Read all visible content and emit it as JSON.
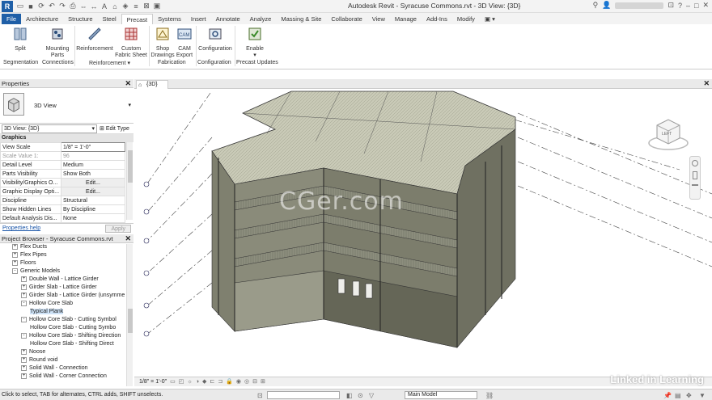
{
  "titlebar": {
    "logo": "R",
    "title": "Autodesk Revit - Syracuse Commons.rvt - 3D View: {3D}"
  },
  "ribbon_tabs": [
    "File",
    "Architecture",
    "Structure",
    "Steel",
    "Precast",
    "Systems",
    "Insert",
    "Annotate",
    "Analyze",
    "Massing & Site",
    "Collaborate",
    "View",
    "Manage",
    "Add-Ins",
    "Modify"
  ],
  "ribbon": {
    "buttons": {
      "split": "Split",
      "mounting": "Mounting Parts",
      "reinforcement": "Reinforcement",
      "custom_fabric": "Custom Fabric Sheet",
      "shop_drawings": "Shop Drawings",
      "cam_export": "CAM Export",
      "configuration": "Configuration",
      "enable": "Enable"
    },
    "groups": {
      "segmentation": "Segmentation",
      "connections": "Connections",
      "reinforcement": "Reinforcement ▾",
      "fabrication": "Fabrication",
      "configuration": "Configuration",
      "updates": "Precast Updates"
    }
  },
  "properties": {
    "title": "Properties",
    "type_name": "3D View",
    "view_select": "3D View: {3D}",
    "edit_type": "Edit Type",
    "section": "Graphics",
    "rows": [
      {
        "k": "View Scale",
        "v": "1/8\" = 1'-0\""
      },
      {
        "k": "Scale Value    1:",
        "v": "96"
      },
      {
        "k": "Detail Level",
        "v": "Medium"
      },
      {
        "k": "Parts Visibility",
        "v": "Show Both"
      },
      {
        "k": "Visibility/Graphics O...",
        "v": "Edit..."
      },
      {
        "k": "Graphic Display Opti...",
        "v": "Edit..."
      },
      {
        "k": "Discipline",
        "v": "Structural"
      },
      {
        "k": "Show Hidden Lines",
        "v": "By Discipline"
      },
      {
        "k": "Default Analysis Dis...",
        "v": "None"
      }
    ],
    "help": "Properties help",
    "apply": "Apply"
  },
  "browser": {
    "title": "Project Browser - Syracuse Commons.rvt",
    "items": [
      {
        "label": "Flex Ducts",
        "indent": 1,
        "exp": "+"
      },
      {
        "label": "Flex Pipes",
        "indent": 1,
        "exp": "+"
      },
      {
        "label": "Floors",
        "indent": 1,
        "exp": "+"
      },
      {
        "label": "Generic Models",
        "indent": 1,
        "exp": "-"
      },
      {
        "label": "Double Wall - Lattice Girder",
        "indent": 2,
        "exp": "+"
      },
      {
        "label": "Girder Slab - Lattice Girder",
        "indent": 2,
        "exp": "+"
      },
      {
        "label": "Girder Slab - Lattice Girder (unsymme",
        "indent": 2,
        "exp": "+"
      },
      {
        "label": "Hollow Core Slab",
        "indent": 2,
        "exp": "-"
      },
      {
        "label": "Typical Plank",
        "indent": 3,
        "exp": "",
        "sel": true
      },
      {
        "label": "Hollow Core Slab - Cutting Symbol",
        "indent": 2,
        "exp": "-"
      },
      {
        "label": "Hollow Core Slab - Cutting Symbo",
        "indent": 3,
        "exp": ""
      },
      {
        "label": "Hollow Core Slab - Shifting Direction",
        "indent": 2,
        "exp": "-"
      },
      {
        "label": "Hollow Core Slab - Shifting Direct",
        "indent": 3,
        "exp": ""
      },
      {
        "label": "Noose",
        "indent": 2,
        "exp": "+"
      },
      {
        "label": "Round void",
        "indent": 2,
        "exp": "+"
      },
      {
        "label": "Solid Wall - Connection",
        "indent": 2,
        "exp": "+"
      },
      {
        "label": "Solid Wall - Corner Connection",
        "indent": 2,
        "exp": "+"
      }
    ]
  },
  "view": {
    "tab_label": "{3D}",
    "watermark": "CGer.com",
    "viewcube": "LEFT",
    "scale": "1/8\" = 1'-0\""
  },
  "brand": "Linked in Learning",
  "status": {
    "message": "Click to select, TAB for alternates, CTRL adds, SHIFT unselects.",
    "model": "Main Model"
  }
}
